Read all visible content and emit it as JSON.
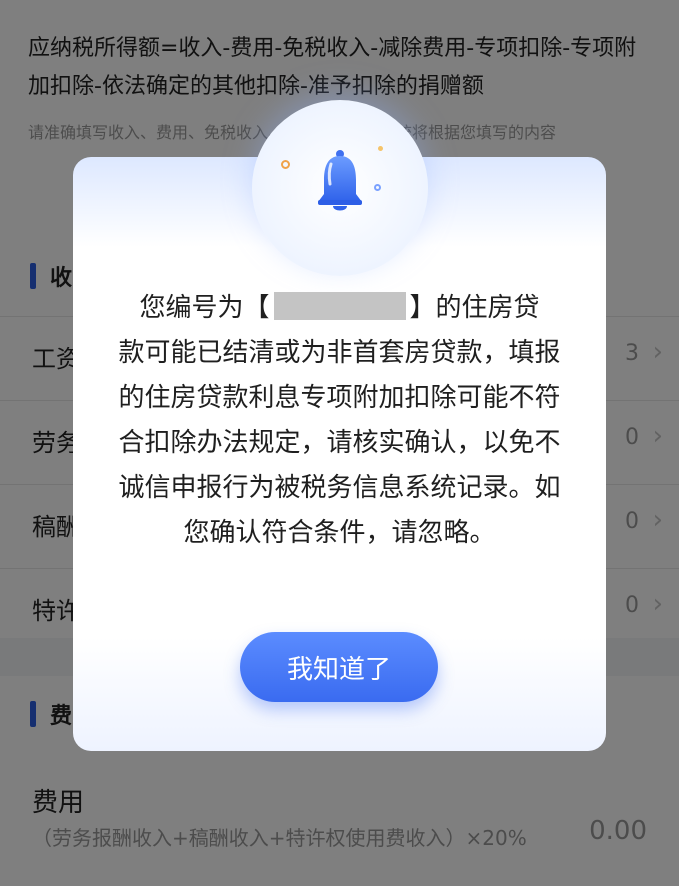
{
  "background": {
    "formula": "应纳税所得额=收入-费用-免税收入-减除费用-专项扣除-专项附加扣除-依法确定的其他扣除-准予扣除的捐赠额",
    "note": "请准确填写收入、费用、免税收入、扣除等信息，系统将根据您填写的内容",
    "income_section_title": "收",
    "rows": [
      {
        "label": "工资",
        "value": "3"
      },
      {
        "label": "劳务",
        "value": "0"
      },
      {
        "label": "稿酬",
        "value": "0"
      },
      {
        "label": "特许",
        "value": "0"
      }
    ],
    "fee_section_title": "费",
    "fee_label": "费用",
    "fee_formula": "（劳务报酬收入+稿酬收入+特许权使用费收入）×20%",
    "fee_value": "0.00"
  },
  "dialog": {
    "message_line1_pre": "您编号为【",
    "message_line1_post": "】的住房贷",
    "message_rest": "款可能已结清或为非首套房贷款，填报的住房贷款利息专项附加扣除可能不符合扣除办法规定，请核实确认，以免不诚信申报行为被税务信息系统记录。如您确认符合条件，请忽略。",
    "confirm_label": "我知道了",
    "icon": "bell-icon"
  },
  "colors": {
    "accent": "#3a6bf0",
    "overlay": "rgba(0,0,0,0.5)"
  }
}
